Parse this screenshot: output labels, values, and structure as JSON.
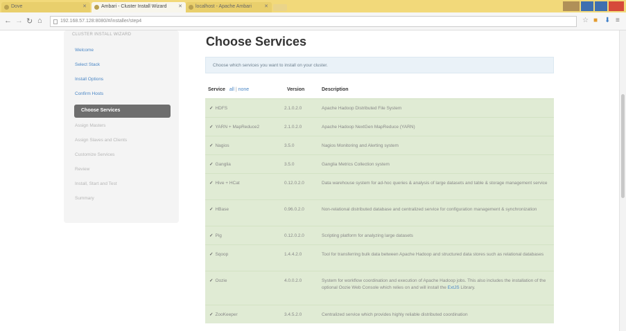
{
  "browser": {
    "tabs": [
      {
        "label": "Dove"
      },
      {
        "label": "Ambari - Cluster Install Wizard"
      },
      {
        "label": "localhost - Apache Ambari"
      }
    ],
    "address": "192.168.57.128:8080/#/installer/step4",
    "icons": {
      "back": "back-arrow-icon",
      "forward": "forward-arrow-icon",
      "reload": "reload-icon",
      "home": "home-icon",
      "star": "star-icon"
    }
  },
  "sidebar": {
    "title": "CLUSTER INSTALL WIZARD",
    "items": [
      {
        "label": "Welcome",
        "state": "done"
      },
      {
        "label": "Select Stack",
        "state": "done"
      },
      {
        "label": "Install Options",
        "state": "done"
      },
      {
        "label": "Confirm Hosts",
        "state": "done"
      },
      {
        "label": "Choose Services",
        "state": "active"
      },
      {
        "label": "Assign Masters",
        "state": "todo"
      },
      {
        "label": "Assign Slaves and Clients",
        "state": "todo"
      },
      {
        "label": "Customize Services",
        "state": "todo"
      },
      {
        "label": "Review",
        "state": "todo"
      },
      {
        "label": "Install, Start and Test",
        "state": "todo"
      },
      {
        "label": "Summary",
        "state": "todo"
      }
    ]
  },
  "main": {
    "title": "Choose Services",
    "instructions": "Choose which services you want to install on your cluster.",
    "headers": {
      "service": "Service",
      "all": "all",
      "separator": "|",
      "none": "none",
      "version": "Version",
      "description": "Description"
    },
    "services": [
      {
        "name": "HDFS",
        "version": "2.1.0.2.0",
        "description": "Apache Hadoop Distributed File System",
        "link": "",
        "checked": true
      },
      {
        "name": "YARN + MapReduce2",
        "version": "2.1.0.2.0",
        "description": "Apache Hadoop NextGen MapReduce (YARN)",
        "link": "",
        "checked": true
      },
      {
        "name": "Nagios",
        "version": "3.5.0",
        "description": "Nagios Monitoring and Alerting system",
        "link": "",
        "checked": true
      },
      {
        "name": "Ganglia",
        "version": "3.5.0",
        "description": "Ganglia Metrics Collection system",
        "link": "",
        "checked": true
      },
      {
        "name": "Hive + HCat",
        "version": "0.12.0.2.0",
        "description": "Data warehouse system for ad-hoc queries & analysis of large datasets and table & storage management service",
        "link": "",
        "checked": true
      },
      {
        "name": "HBase",
        "version": "0.96.0.2.0",
        "description": "Non-relational distributed database and centralized service for configuration management & synchronization",
        "link": "",
        "checked": true
      },
      {
        "name": "Pig",
        "version": "0.12.0.2.0",
        "description": "Scripting platform for analyzing large datasets",
        "link": "",
        "checked": true
      },
      {
        "name": "Sqoop",
        "version": "1.4.4.2.0",
        "description": "Tool for transferring bulk data between Apache Hadoop and structured data stores such as relational databases",
        "link": "",
        "checked": true
      },
      {
        "name": "Oozie",
        "version": "4.0.0.2.0",
        "description": "System for workflow coordination and execution of Apache Hadoop jobs. This also includes the installation of the optional Oozie Web Console which relies on and will install the",
        "link": "ExtJS",
        "description_tail": " Library.",
        "checked": true
      },
      {
        "name": "ZooKeeper",
        "version": "3.4.5.2.0",
        "description": "Centralized service which provides highly reliable distributed coordination",
        "link": "",
        "checked": true
      }
    ]
  }
}
